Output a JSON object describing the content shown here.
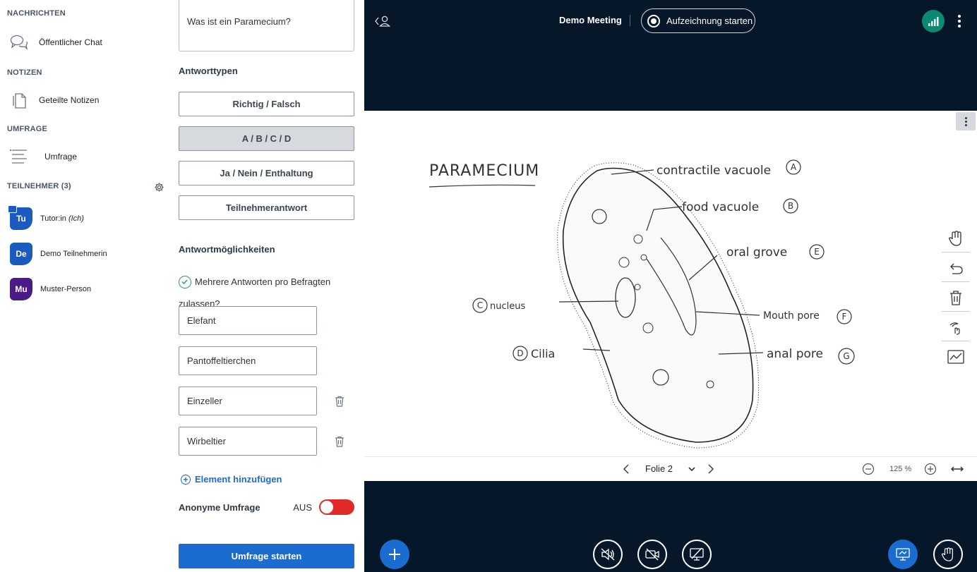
{
  "sidebar": {
    "messages_title": "NACHRICHTEN",
    "public_chat": "Öffentlicher Chat",
    "notes_title": "NOTIZEN",
    "shared_notes": "Geteilte Notizen",
    "poll_title": "UMFRAGE",
    "poll_item": "Umfrage",
    "participants_title": "TEILNEHMER (3)",
    "users": [
      {
        "initials": "Tu",
        "name": "Tutor:in",
        "suffix": "(Ich)",
        "color": "#1b5bbf"
      },
      {
        "initials": "De",
        "name": "Demo Teilnehmerin",
        "suffix": "",
        "color": "#1b5bbf"
      },
      {
        "initials": "Mu",
        "name": "Muster-Person",
        "suffix": "",
        "color": "#4a1a86"
      }
    ]
  },
  "poll": {
    "question": "Was ist ein Paramecium?",
    "types_label": "Antworttypen",
    "types": [
      "Richtig / Falsch",
      "A / B / C / D",
      "Ja / Nein / Enthaltung",
      "Teilnehmerantwort"
    ],
    "selected_type": "A / B / C / D",
    "options_label": "Antwortmöglichkeiten",
    "multi_answer_text": "Mehrere Antworten pro Befragten zulassen?",
    "options": [
      "Elefant",
      "Pantoffeltierchen",
      "Einzeller",
      "Wirbeltier"
    ],
    "add_element": "Element hinzufügen",
    "anonymous_label": "Anonyme Umfrage",
    "anonymous_state": "AUS",
    "start_button": "Umfrage starten"
  },
  "meeting": {
    "title": "Demo Meeting",
    "record_button": "Aufzeichnung starten",
    "slide_label": "Folie 2",
    "zoom": "125 %",
    "accent": "#1b6cd1",
    "background": "#06172a"
  },
  "whiteboard": {
    "heading": "PARAMECIUM",
    "labels": [
      {
        "text": "contractile vacuole",
        "tag": "A"
      },
      {
        "text": "food vacuole",
        "tag": "B"
      },
      {
        "text": "oral grove",
        "tag": "E"
      },
      {
        "text": "Mouth pore",
        "tag": "F"
      },
      {
        "text": "anal pore",
        "tag": "G"
      },
      {
        "text": "nucleus",
        "tag": "C"
      },
      {
        "text": "Cilia",
        "tag": "D"
      }
    ]
  },
  "icons": [
    "chat-icon",
    "notes-icon",
    "poll-list-icon",
    "gear-icon",
    "trash-icon",
    "plus-icon",
    "record-icon",
    "signal-icon",
    "hand-icon",
    "undo-icon",
    "pen-icon",
    "chart-icon",
    "mute-audio-icon",
    "video-off-icon",
    "screenshare-off-icon",
    "presentation-icon",
    "raise-hand-icon"
  ]
}
